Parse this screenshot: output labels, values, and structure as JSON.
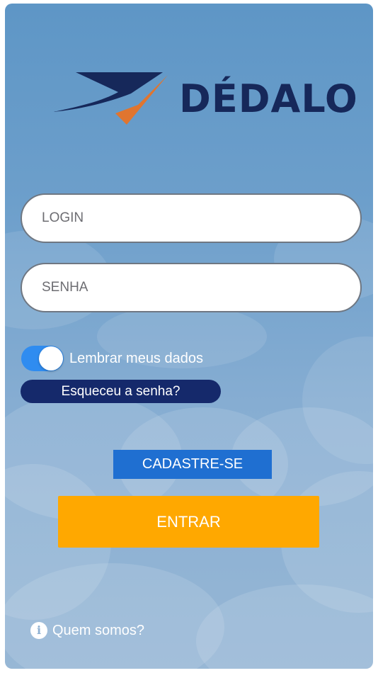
{
  "app": {
    "logo_text": "DÉDALO"
  },
  "login": {
    "login_placeholder": "LOGIN",
    "password_placeholder": "SENHA",
    "remember_label": "Lembrar meus dados",
    "remember_enabled": true,
    "forgot_label": "Esqueceu a senha?",
    "register_label": "CADASTRE-SE",
    "enter_label": "ENTRAR"
  },
  "footer": {
    "about_label": "Quem somos?",
    "about_icon": "info-icon"
  },
  "colors": {
    "brand_navy": "#16285a",
    "brand_orange": "#e0752f",
    "toggle_on": "#2f8cf0",
    "forgot_bg": "#15296b",
    "register_bg": "#1f6fd1",
    "enter_bg": "#ffa800"
  }
}
